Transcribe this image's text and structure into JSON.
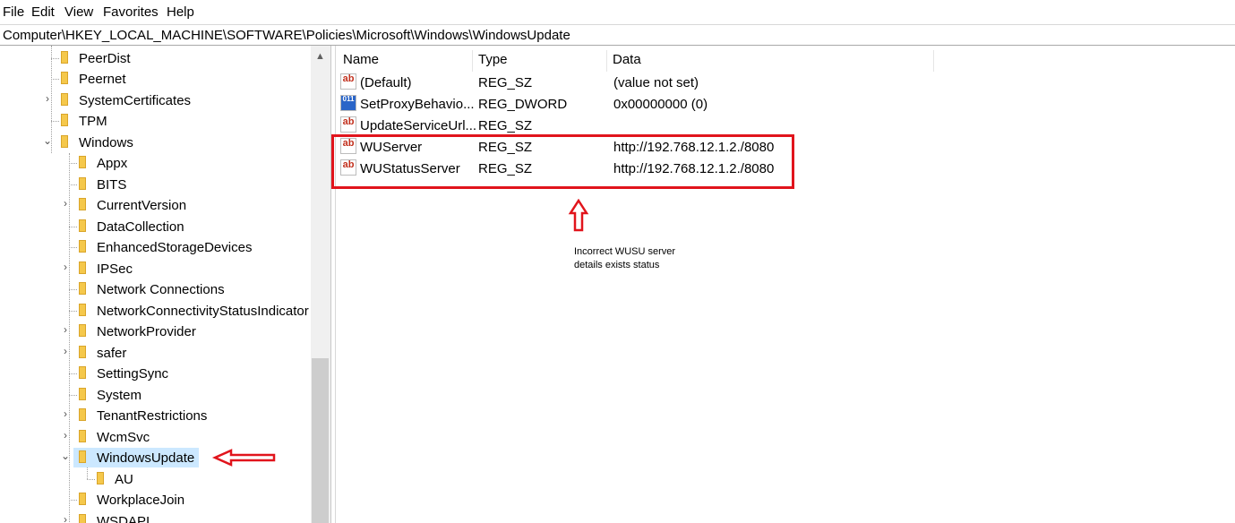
{
  "menu": [
    "File",
    "Edit",
    "View",
    "Favorites",
    "Help"
  ],
  "address": "Computer\\HKEY_LOCAL_MACHINE\\SOFTWARE\\Policies\\Microsoft\\Windows\\WindowsUpdate",
  "tree": [
    {
      "label": "PeerDist",
      "expandable": false
    },
    {
      "label": "Peernet",
      "expandable": false
    },
    {
      "label": "SystemCertificates",
      "expandable": true,
      "expanded": false
    },
    {
      "label": "TPM",
      "expandable": false
    },
    {
      "label": "Windows",
      "expandable": true,
      "expanded": true
    },
    {
      "label": "Appx",
      "expandable": false
    },
    {
      "label": "BITS",
      "expandable": false
    },
    {
      "label": "CurrentVersion",
      "expandable": true,
      "expanded": false
    },
    {
      "label": "DataCollection",
      "expandable": false
    },
    {
      "label": "EnhancedStorageDevices",
      "expandable": false
    },
    {
      "label": "IPSec",
      "expandable": true,
      "expanded": false
    },
    {
      "label": "Network Connections",
      "expandable": false
    },
    {
      "label": "NetworkConnectivityStatusIndicator",
      "expandable": false
    },
    {
      "label": "NetworkProvider",
      "expandable": true,
      "expanded": false
    },
    {
      "label": "safer",
      "expandable": true,
      "expanded": false
    },
    {
      "label": "SettingSync",
      "expandable": false
    },
    {
      "label": "System",
      "expandable": false
    },
    {
      "label": "TenantRestrictions",
      "expandable": true,
      "expanded": false
    },
    {
      "label": "WcmSvc",
      "expandable": true,
      "expanded": false
    },
    {
      "label": "WindowsUpdate",
      "expandable": true,
      "expanded": true,
      "selected": true
    },
    {
      "label": "AU",
      "expandable": false
    },
    {
      "label": "WorkplaceJoin",
      "expandable": false
    },
    {
      "label": "WSDAPI",
      "expandable": true,
      "expanded": false
    }
  ],
  "columns": {
    "name": "Name",
    "type": "Type",
    "data": "Data"
  },
  "values": [
    {
      "icon": "string-value-icon",
      "icon_text": "ab",
      "name": "(Default)",
      "type": "REG_SZ",
      "data": "(value not set)"
    },
    {
      "icon": "dword-value-icon",
      "icon_text": "011",
      "name": "SetProxyBehavio...",
      "type": "REG_DWORD",
      "data": "0x00000000 (0)"
    },
    {
      "icon": "string-value-icon",
      "icon_text": "ab",
      "name": "UpdateServiceUrl...",
      "type": "REG_SZ",
      "data": ""
    },
    {
      "icon": "string-value-icon",
      "icon_text": "ab",
      "name": "WUServer",
      "type": "REG_SZ",
      "data": "http://192.768.12.1.2./8080"
    },
    {
      "icon": "string-value-icon",
      "icon_text": "ab",
      "name": "WUStatusServer",
      "type": "REG_SZ",
      "data": "http://192.768.12.1.2./8080"
    }
  ],
  "annotation": {
    "line1": "Incorrect WUSU server",
    "line2": "details exists status"
  },
  "colors": {
    "highlight": "#e1141c",
    "selection": "#cce8ff",
    "folder": "#f5c84b"
  }
}
